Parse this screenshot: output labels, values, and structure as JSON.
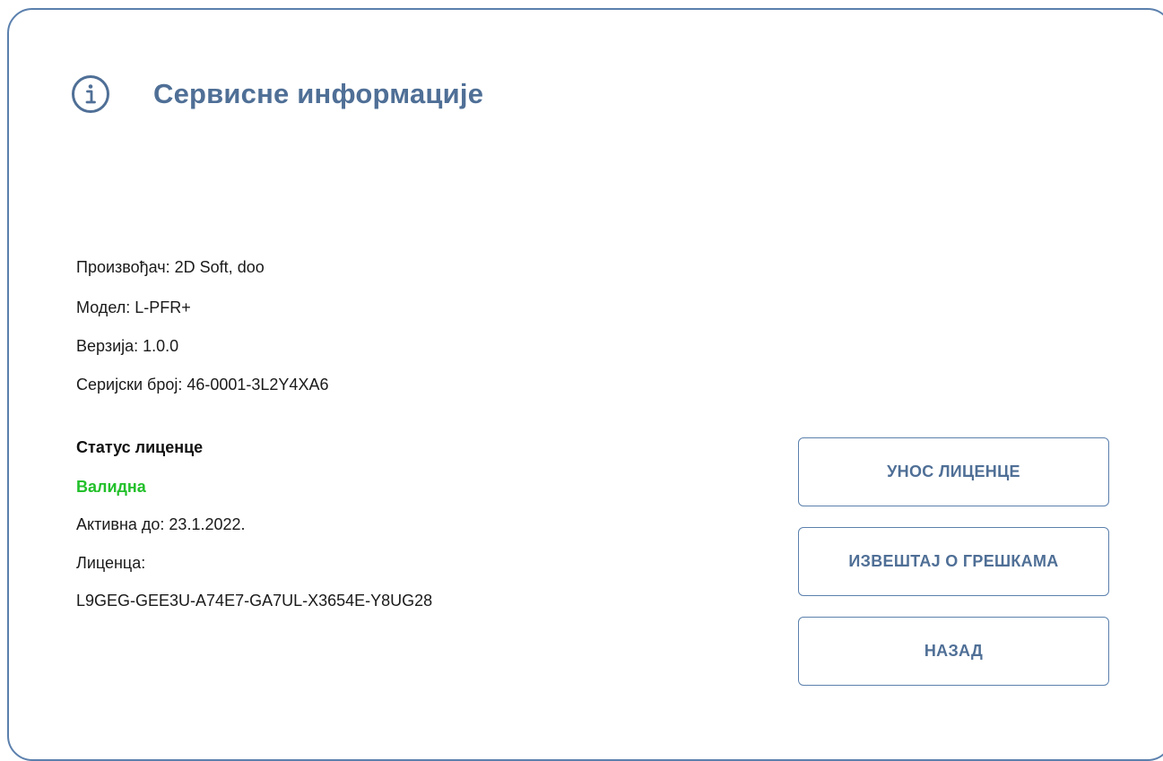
{
  "header": {
    "icon": "info-icon",
    "title": "Сервисне информације"
  },
  "device_info": {
    "manufacturer": {
      "label": "Произвођач:",
      "value": "2D Soft, doo"
    },
    "model": {
      "label": "Модел:",
      "value": "L-PFR+"
    },
    "version": {
      "label": "Верзија:",
      "value": "1.0.0"
    },
    "serial": {
      "label": "Серијски број:",
      "value": "46-0001-3L2Y4XA6"
    }
  },
  "license": {
    "heading": "Статус лиценце",
    "status": "Валидна",
    "active_until": {
      "label": "Активна до:",
      "value": "23.1.2022."
    },
    "license_label": "Лиценца:",
    "license_key": "L9GEG-GEE3U-A74E7-GA7UL-X3654E-Y8UG28"
  },
  "buttons": {
    "enter_license": "УНОС ЛИЦЕНЦЕ",
    "error_report": "ИЗВЕШТАЈ О ГРЕШКАМА",
    "back": "НАЗАД"
  },
  "colors": {
    "accent": "#4f6f96",
    "border": "#5b80ad",
    "status_valid": "#22c02a"
  }
}
